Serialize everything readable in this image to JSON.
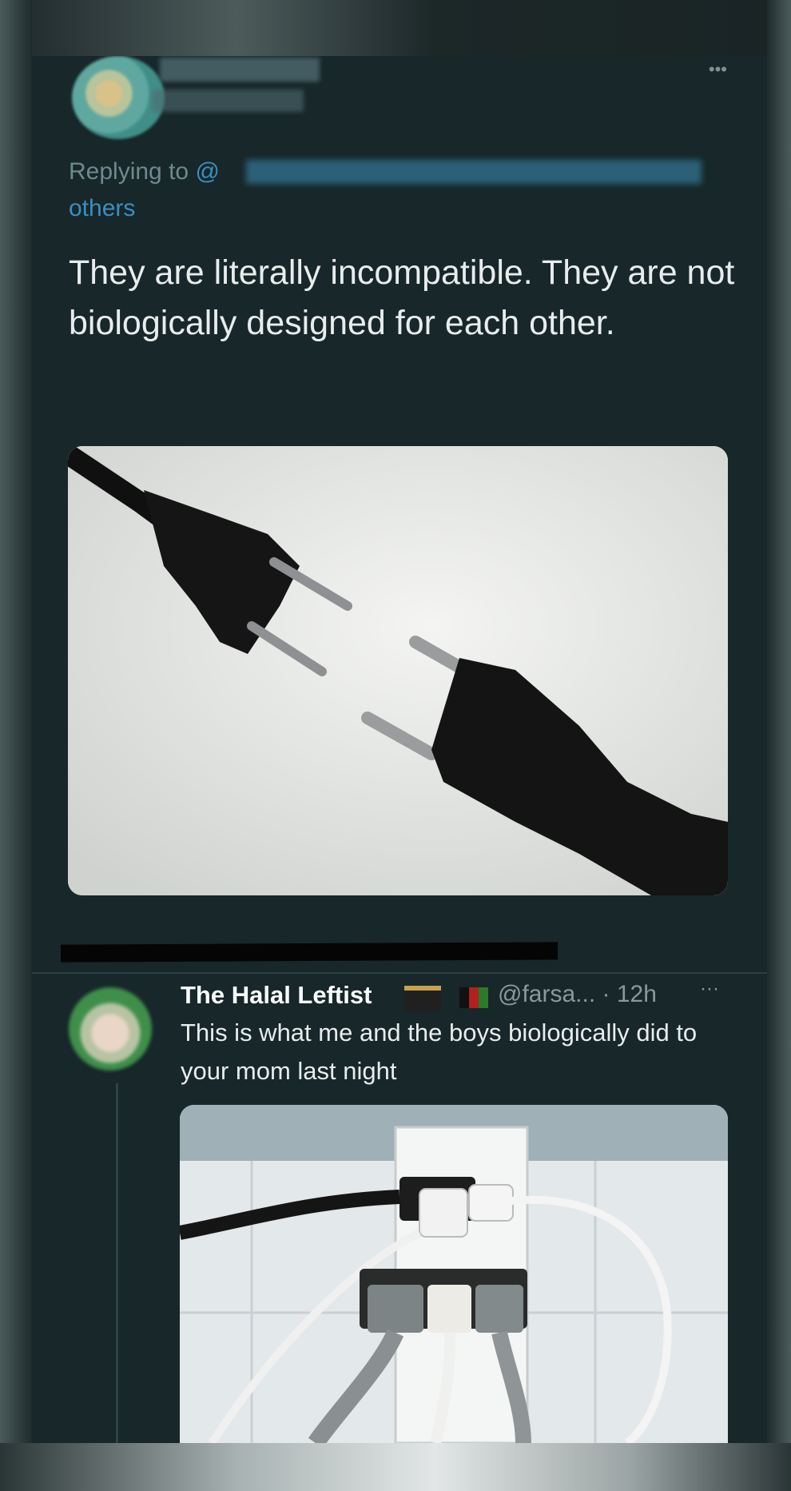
{
  "reply_tweet": {
    "replying_to_prefix": "Replying to ",
    "at_symbol": "@",
    "others_label": "others",
    "text": "They are literally incompatible. They are not biologically designed for each other.",
    "more_icon": "ellipsis-icon"
  },
  "quoted_tweet": {
    "author_name": "The Halal Leftist",
    "handle": "@farsa...",
    "time": "· 12h",
    "more_label": "···",
    "text": "This is what me and the boys biologically did to your mom last night",
    "name_emojis": [
      "kaaba-icon",
      "afghanistan-flag-icon"
    ]
  },
  "colors": {
    "background": "#17272a",
    "text": "#e8ecec",
    "link": "#3a8fc0",
    "muted": "#8a9a9c"
  }
}
